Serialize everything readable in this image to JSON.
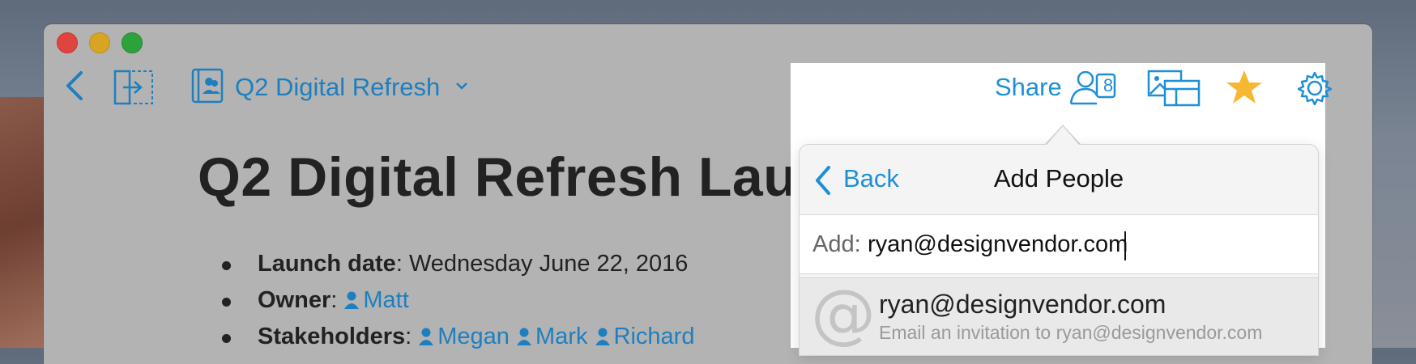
{
  "toolbar": {
    "doc_title": "Q2 Digital Refresh",
    "share_label": "Share",
    "share_count": "8",
    "icons": [
      "back-chevron-icon",
      "side-panel-icon",
      "shared-folder-icon",
      "chevron-down-icon",
      "people-icon",
      "gallery-icon",
      "star-icon",
      "gear-icon"
    ],
    "star_color": "#f7b731",
    "accent_color": "#1e8fd6"
  },
  "document": {
    "heading": "Q2 Digital Refresh Lau",
    "bullets": [
      {
        "label": "Launch date",
        "sep": ": ",
        "value": "Wednesday June 22, 2016"
      },
      {
        "label": "Owner",
        "sep": ": ",
        "people": [
          "Matt"
        ]
      },
      {
        "label": "Stakeholders",
        "sep": ": ",
        "people": [
          "Megan",
          "Mark",
          "Richard"
        ]
      }
    ]
  },
  "popover": {
    "back_label": "Back",
    "title": "Add People",
    "add_prefix": "Add:",
    "add_value": "ryan@designvendor.com",
    "suggestion": {
      "icon": "at-icon",
      "email": "ryan@designvendor.com",
      "subtitle": "Email an invitation to ryan@designvendor.com"
    }
  }
}
